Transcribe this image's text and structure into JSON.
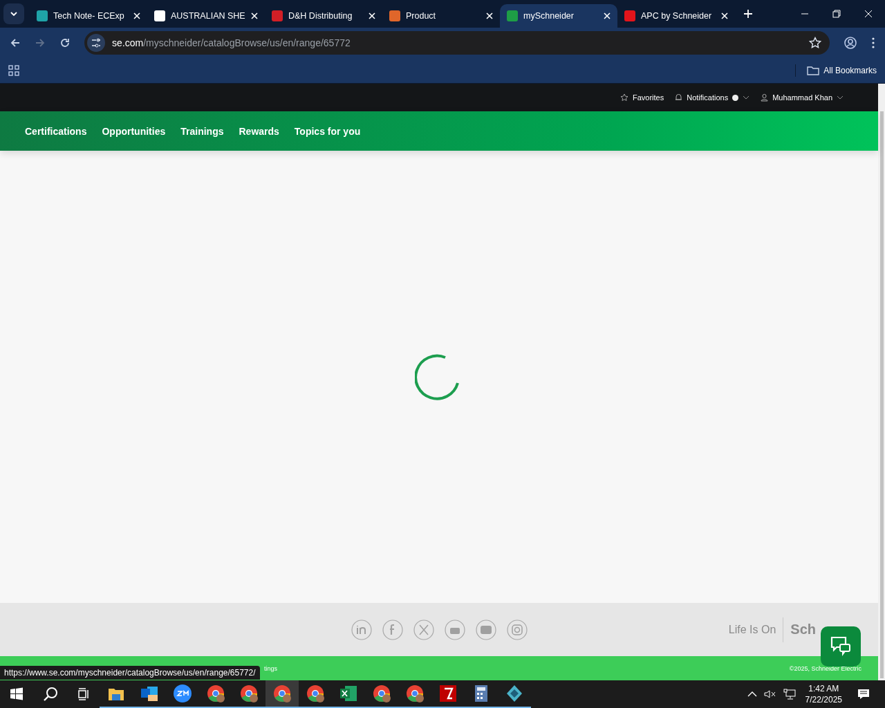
{
  "browser": {
    "tabs": [
      {
        "title": "Tech Note- ECExp",
        "selected": false
      },
      {
        "title": "AUSTRALIAN SHE",
        "selected": false
      },
      {
        "title": "D&H Distributing",
        "selected": false
      },
      {
        "title": "Product",
        "selected": false
      },
      {
        "title": "mySchneider",
        "selected": true
      },
      {
        "title": "APC by Schneider",
        "selected": false
      }
    ],
    "address": {
      "host": "se.com",
      "path": "/myschneider/catalogBrowse/us/en/range/65772"
    },
    "bookmarks": {
      "label": "All Bookmarks"
    }
  },
  "page": {
    "top_links": [
      {
        "label": "Favorites",
        "kind": "star"
      },
      {
        "label": "Notifications",
        "kind": "bell"
      },
      {
        "label": "Muhammad Khan",
        "kind": "user"
      }
    ],
    "nav": [
      "Certifications",
      "Opportunities",
      "Trainings",
      "Rewards",
      "Topics for you"
    ],
    "footer": {
      "slogan": "Life Is On",
      "brand": "Sch",
      "links_fragment": "tings",
      "copyright": "©2025, Schneider Electric"
    }
  },
  "status_url": "https://www.se.com/myschneider/catalogBrowse/us/en/range/65772/",
  "taskbar": {
    "apps": [
      {
        "kind": "explorer",
        "running": true,
        "selected": false
      },
      {
        "kind": "outlook",
        "running": true,
        "selected": false
      },
      {
        "kind": "zoom",
        "running": true,
        "selected": false
      },
      {
        "kind": "chrome",
        "running": true,
        "selected": false
      },
      {
        "kind": "chrome",
        "running": true,
        "selected": false
      },
      {
        "kind": "chrome",
        "running": true,
        "selected": true
      },
      {
        "kind": "chrome",
        "running": true,
        "selected": false
      },
      {
        "kind": "excel",
        "running": true,
        "selected": false
      },
      {
        "kind": "chrome",
        "running": true,
        "selected": false
      },
      {
        "kind": "chrome",
        "running": true,
        "selected": false
      },
      {
        "kind": "filezilla",
        "running": true,
        "selected": false
      },
      {
        "kind": "calculator",
        "running": true,
        "selected": false
      },
      {
        "kind": "diamond",
        "running": true,
        "selected": false
      }
    ],
    "time": "1:42 AM",
    "date": "7/22/2025"
  }
}
